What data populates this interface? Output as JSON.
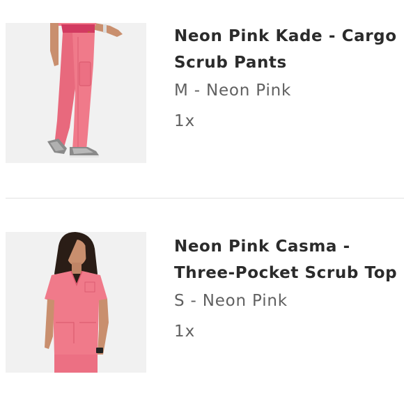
{
  "items": [
    {
      "title_line1": "Neon Pink Kade - Cargo",
      "title_line2": "Scrub Pants",
      "variant": "M - Neon Pink",
      "quantity": "1x",
      "image_icon": "scrub-pants-photo"
    },
    {
      "title_line1": "Neon Pink Casma -",
      "title_line2": "Three-Pocket Scrub Top",
      "variant": "S - Neon Pink",
      "quantity": "1x",
      "image_icon": "scrub-top-photo"
    }
  ],
  "colors": {
    "product_pink": "#f07a8a",
    "product_pink_dark": "#d9566b",
    "waistband": "#d23a60",
    "skin": "#c98f6e",
    "hair": "#2a1d16",
    "image_bg": "#f1f1f1",
    "title_text": "#2b2b2b",
    "secondary_text": "#606060",
    "divider": "#e2e2e2"
  }
}
